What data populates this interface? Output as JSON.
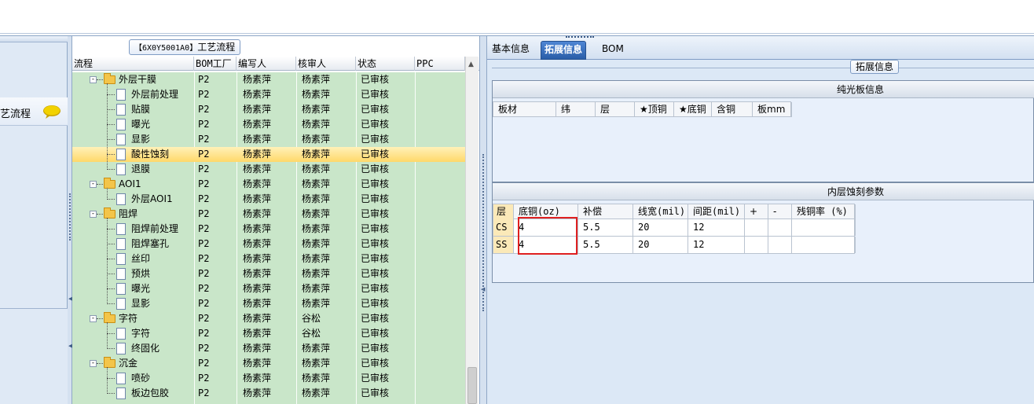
{
  "left_nav": {
    "item_label": "艺流程",
    "icon": "speech-bubble-icon"
  },
  "tree": {
    "title_code": "【6X0Y5001A0】",
    "title_text": "工艺流程",
    "columns": [
      "流程",
      "BOM工厂",
      "编写人",
      "核审人",
      "状态",
      "PPC"
    ],
    "rows": [
      {
        "name": "外层干膜",
        "type": "folder",
        "level": 0,
        "bom": "P2",
        "writer": "杨素萍",
        "reviewer": "杨素萍",
        "status": "已审核"
      },
      {
        "name": "外层前处理",
        "type": "doc",
        "level": 1,
        "bom": "P2",
        "writer": "杨素萍",
        "reviewer": "杨素萍",
        "status": "已审核"
      },
      {
        "name": "贴膜",
        "type": "doc",
        "level": 1,
        "bom": "P2",
        "writer": "杨素萍",
        "reviewer": "杨素萍",
        "status": "已审核"
      },
      {
        "name": "曝光",
        "type": "doc",
        "level": 1,
        "bom": "P2",
        "writer": "杨素萍",
        "reviewer": "杨素萍",
        "status": "已审核"
      },
      {
        "name": "显影",
        "type": "doc",
        "level": 1,
        "bom": "P2",
        "writer": "杨素萍",
        "reviewer": "杨素萍",
        "status": "已审核"
      },
      {
        "name": "酸性蚀刻",
        "type": "doc",
        "level": 1,
        "bom": "P2",
        "writer": "杨素萍",
        "reviewer": "杨素萍",
        "status": "已审核",
        "selected": true
      },
      {
        "name": "退膜",
        "type": "doc",
        "level": 1,
        "bom": "P2",
        "writer": "杨素萍",
        "reviewer": "杨素萍",
        "status": "已审核"
      },
      {
        "name": "AOI1",
        "type": "folder",
        "level": 0,
        "bom": "P2",
        "writer": "杨素萍",
        "reviewer": "杨素萍",
        "status": "已审核"
      },
      {
        "name": "外层AOI1",
        "type": "doc",
        "level": 1,
        "bom": "P2",
        "writer": "杨素萍",
        "reviewer": "杨素萍",
        "status": "已审核"
      },
      {
        "name": "阻焊",
        "type": "folder",
        "level": 0,
        "bom": "P2",
        "writer": "杨素萍",
        "reviewer": "杨素萍",
        "status": "已审核"
      },
      {
        "name": "阻焊前处理",
        "type": "doc",
        "level": 1,
        "bom": "P2",
        "writer": "杨素萍",
        "reviewer": "杨素萍",
        "status": "已审核"
      },
      {
        "name": "阻焊塞孔",
        "type": "doc",
        "level": 1,
        "bom": "P2",
        "writer": "杨素萍",
        "reviewer": "杨素萍",
        "status": "已审核"
      },
      {
        "name": "丝印",
        "type": "doc",
        "level": 1,
        "bom": "P2",
        "writer": "杨素萍",
        "reviewer": "杨素萍",
        "status": "已审核"
      },
      {
        "name": "预烘",
        "type": "doc",
        "level": 1,
        "bom": "P2",
        "writer": "杨素萍",
        "reviewer": "杨素萍",
        "status": "已审核"
      },
      {
        "name": "曝光",
        "type": "doc",
        "level": 1,
        "bom": "P2",
        "writer": "杨素萍",
        "reviewer": "杨素萍",
        "status": "已审核"
      },
      {
        "name": "显影",
        "type": "doc",
        "level": 1,
        "bom": "P2",
        "writer": "杨素萍",
        "reviewer": "杨素萍",
        "status": "已审核"
      },
      {
        "name": "字符",
        "type": "folder",
        "level": 0,
        "bom": "P2",
        "writer": "杨素萍",
        "reviewer": "谷松",
        "status": "已审核"
      },
      {
        "name": "字符",
        "type": "doc",
        "level": 1,
        "bom": "P2",
        "writer": "杨素萍",
        "reviewer": "谷松",
        "status": "已审核"
      },
      {
        "name": "终固化",
        "type": "doc",
        "level": 1,
        "bom": "P2",
        "writer": "杨素萍",
        "reviewer": "杨素萍",
        "status": "已审核"
      },
      {
        "name": "沉金",
        "type": "folder",
        "level": 0,
        "bom": "P2",
        "writer": "杨素萍",
        "reviewer": "杨素萍",
        "status": "已审核"
      },
      {
        "name": "喷砂",
        "type": "doc",
        "level": 1,
        "bom": "P2",
        "writer": "杨素萍",
        "reviewer": "杨素萍",
        "status": "已审核"
      },
      {
        "name": "板边包胶",
        "type": "doc",
        "level": 1,
        "bom": "P2",
        "writer": "杨素萍",
        "reviewer": "杨素萍",
        "status": "已审核"
      }
    ]
  },
  "right": {
    "tabs": [
      "基本信息",
      "拓展信息",
      "BOM"
    ],
    "active_tab": "拓展信息",
    "group_title": "拓展信息",
    "section1": {
      "title": "纯光板信息",
      "columns": [
        "板材",
        "纬",
        "层",
        "★顶铜",
        "★底铜",
        "含铜",
        "板mm"
      ]
    },
    "section2": {
      "title": "内层蚀刻参数",
      "columns": [
        "层",
        "底铜(oz)",
        "补偿",
        "线宽(mil)",
        "间距(mil)",
        "+",
        "-",
        "残铜率 (%)"
      ],
      "rows": [
        [
          "CS",
          "4",
          "5.5",
          "20",
          "12",
          "",
          "",
          ""
        ],
        [
          "SS",
          "4",
          "5.5",
          "20",
          "12",
          "",
          "",
          ""
        ]
      ]
    }
  },
  "colors": {
    "tree_bg": "#c9e6c9",
    "selected_row": "#ffd86a",
    "active_tab": "#2a5ea8",
    "highlight_box": "#e02020"
  }
}
